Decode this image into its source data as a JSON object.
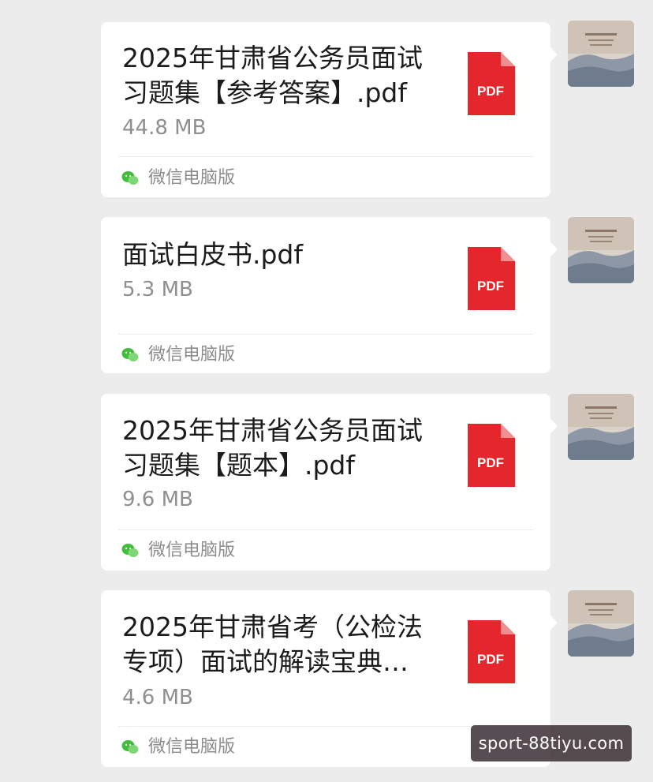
{
  "messages": [
    {
      "file_name": "2025年甘肃省公务员面试习题集【参考答案】.pdf",
      "file_size": "44.8 MB",
      "file_type": "PDF",
      "source": "微信电脑版"
    },
    {
      "file_name": "面试白皮书.pdf",
      "file_size": "5.3 MB",
      "file_type": "PDF",
      "source": "微信电脑版"
    },
    {
      "file_name": "2025年甘肃省公务员面试习题集【题本】.pdf",
      "file_size": "9.6 MB",
      "file_type": "PDF",
      "source": "微信电脑版"
    },
    {
      "file_name": "2025年甘肃省考（公检法专项）面试的解读宝典…",
      "file_size": "4.6 MB",
      "file_type": "PDF",
      "source": "微信电脑版"
    }
  ],
  "watermark": "sport-88tiyu.com",
  "colors": {
    "chat_background": "#ebeceb",
    "bubble": "#ffffff",
    "pdf_red": "#e5262c",
    "wechat_green": "#3fbd3b"
  },
  "icons": {
    "file": "pdf-file-icon",
    "source": "wechat-logo-icon",
    "sender": "landscape-avatar"
  }
}
